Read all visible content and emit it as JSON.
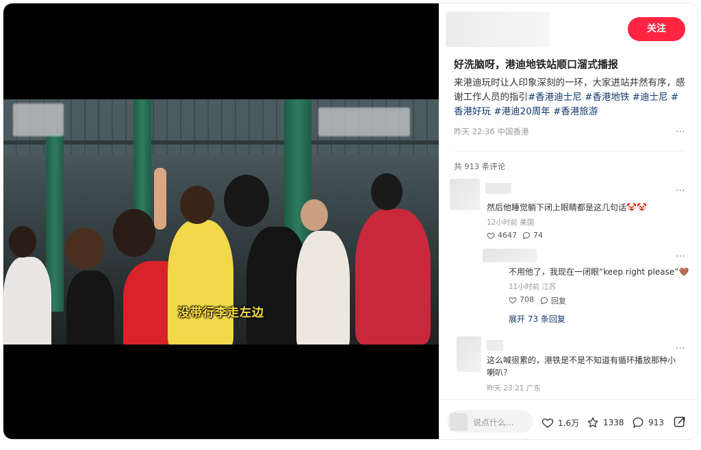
{
  "video": {
    "subtitle": "没带行李走左边"
  },
  "note": {
    "follow_label": "关注",
    "title": "好洗脑呀，港迪地铁站顺口溜式播报",
    "desc_text": "来港迪玩时让人印象深刻的一环，大家进站井然有序，感谢工作人员的指引",
    "tags": [
      "#香港迪士尼",
      "#香港地铁",
      "#迪士尼",
      "#香港好玩",
      "#港迪20周年",
      "#香港旅游"
    ],
    "meta": "昨天 22:36 中国香港",
    "more": "···"
  },
  "comments_header": "共 913 条评论",
  "comments": [
    {
      "text": "然后他睡觉躺下闭上眼睛都是这几句话🤡🤡",
      "meta": "12小时前 美国",
      "likes": "4647",
      "replies": "74",
      "more": "···"
    },
    {
      "text": "不用他了，我现在一闭眼“keep right please”🤎",
      "meta": "11小时前 江苏",
      "likes": "708",
      "reply_label": "回复",
      "more": "···"
    },
    {
      "text": "这么喊很累的，港铁是不是不知道有循环播放那种小喇叭？",
      "meta": "昨天 23:21 广东",
      "more": "···"
    }
  ],
  "expand_label": "展开 73 条回复",
  "bottom": {
    "placeholder": "说点什么...",
    "likes": "1.6万",
    "collects": "1338",
    "comments": "913"
  },
  "colors": {
    "accent": "#ff2442",
    "tag": "#13386c",
    "subtitle": "#ffe24a"
  },
  "icons": {
    "like": "heart-icon",
    "collect": "star-icon",
    "comment": "chat-bubble-icon",
    "share": "share-icon"
  }
}
